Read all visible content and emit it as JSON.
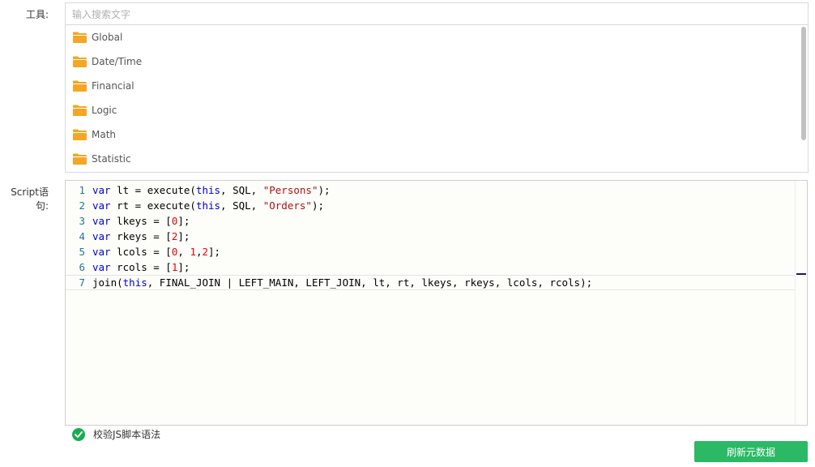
{
  "labels": {
    "tools": "工具:",
    "script": "Script语句:"
  },
  "search": {
    "placeholder": "输入搜索文字",
    "value": ""
  },
  "tree": {
    "items": [
      {
        "label": "Global",
        "icon": "folder-icon"
      },
      {
        "label": "Date/Time",
        "icon": "folder-icon"
      },
      {
        "label": "Financial",
        "icon": "folder-icon"
      },
      {
        "label": "Logic",
        "icon": "folder-icon"
      },
      {
        "label": "Math",
        "icon": "folder-icon"
      },
      {
        "label": "Statistic",
        "icon": "folder-icon"
      }
    ]
  },
  "editor": {
    "lines": [
      {
        "n": "1",
        "tokens": [
          [
            "kw",
            "var"
          ],
          [
            "plain",
            " lt = execute("
          ],
          [
            "kw",
            "this"
          ],
          [
            "plain",
            ", SQL, "
          ],
          [
            "str",
            "\"Persons\""
          ],
          [
            "plain",
            ");"
          ]
        ]
      },
      {
        "n": "2",
        "tokens": [
          [
            "kw",
            "var"
          ],
          [
            "plain",
            " rt = execute("
          ],
          [
            "kw",
            "this"
          ],
          [
            "plain",
            ", SQL, "
          ],
          [
            "str",
            "\"Orders\""
          ],
          [
            "plain",
            ");"
          ]
        ]
      },
      {
        "n": "3",
        "tokens": [
          [
            "kw",
            "var"
          ],
          [
            "plain",
            " lkeys = ["
          ],
          [
            "num",
            "0"
          ],
          [
            "plain",
            "];"
          ]
        ]
      },
      {
        "n": "4",
        "tokens": [
          [
            "kw",
            "var"
          ],
          [
            "plain",
            " rkeys = ["
          ],
          [
            "num",
            "2"
          ],
          [
            "plain",
            "];"
          ]
        ]
      },
      {
        "n": "5",
        "tokens": [
          [
            "kw",
            "var"
          ],
          [
            "plain",
            " lcols = ["
          ],
          [
            "num",
            "0"
          ],
          [
            "plain",
            ", "
          ],
          [
            "num",
            "1"
          ],
          [
            "plain",
            ","
          ],
          [
            "num",
            "2"
          ],
          [
            "plain",
            "];"
          ]
        ]
      },
      {
        "n": "6",
        "tokens": [
          [
            "kw",
            "var"
          ],
          [
            "plain",
            " rcols = ["
          ],
          [
            "num",
            "1"
          ],
          [
            "plain",
            "];"
          ]
        ]
      },
      {
        "n": "7",
        "tokens": [
          [
            "plain",
            "join("
          ],
          [
            "kw",
            "this"
          ],
          [
            "plain",
            ", FINAL_JOIN | LEFT_MAIN, LEFT_JOIN, lt, rt, lkeys, rkeys, lcols, rcols);"
          ]
        ]
      }
    ]
  },
  "validate": {
    "label": "校验JS脚本语法",
    "checked": true,
    "icon": "check-circle-icon"
  },
  "actions": {
    "refresh_label": "刷新元数据"
  },
  "colors": {
    "folder": "#f5a623",
    "check": "#1aac55",
    "button": "#2bb965"
  }
}
